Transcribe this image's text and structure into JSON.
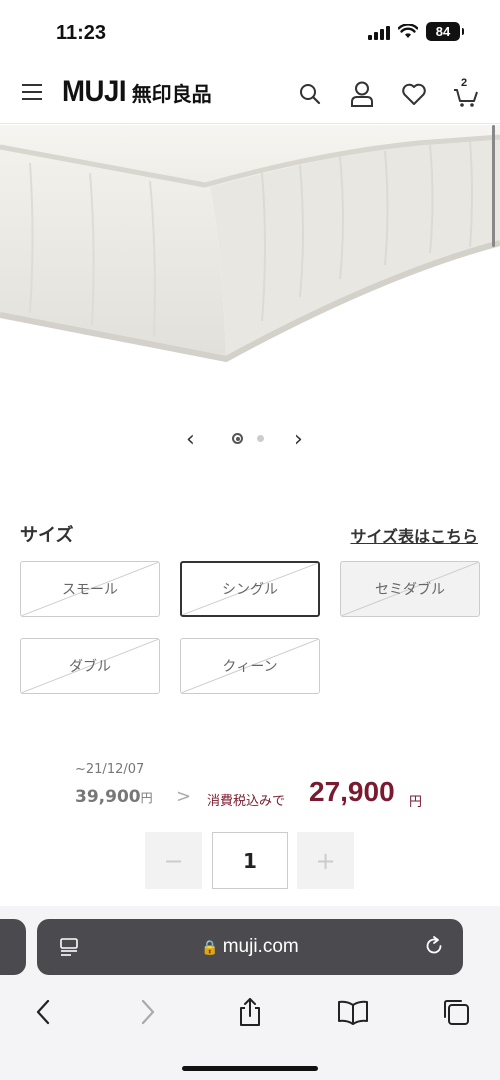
{
  "status_bar": {
    "time": "11:23",
    "battery": "84"
  },
  "header": {
    "logo_en": "MUJI",
    "logo_jp": "無印良品",
    "cart_count": "2"
  },
  "carousel": {
    "prev": "‹",
    "next": "›",
    "current": 1,
    "total": 2
  },
  "size": {
    "title": "サイズ",
    "chart_link": "サイズ表はこちら",
    "options": [
      {
        "label": "スモール",
        "selected": false
      },
      {
        "label": "シングル",
        "selected": true
      },
      {
        "label": "セミダブル",
        "selected": false
      },
      {
        "label": "ダブル",
        "selected": false
      },
      {
        "label": "クィーン",
        "selected": false
      }
    ]
  },
  "price": {
    "old_date": "~21/12/07",
    "old_price": "39,900",
    "old_unit": "円",
    "arrow": ">",
    "tax_label": "消費税込みで",
    "new_price": "27,900",
    "new_unit": "円"
  },
  "quantity": {
    "minus": "−",
    "value": "1",
    "plus": "+"
  },
  "browser": {
    "lock": "🔒",
    "url": "muji.com"
  },
  "colors": {
    "accent": "#7a1a2e",
    "border": "#cccccc",
    "address_bg": "#4a4a4f"
  }
}
